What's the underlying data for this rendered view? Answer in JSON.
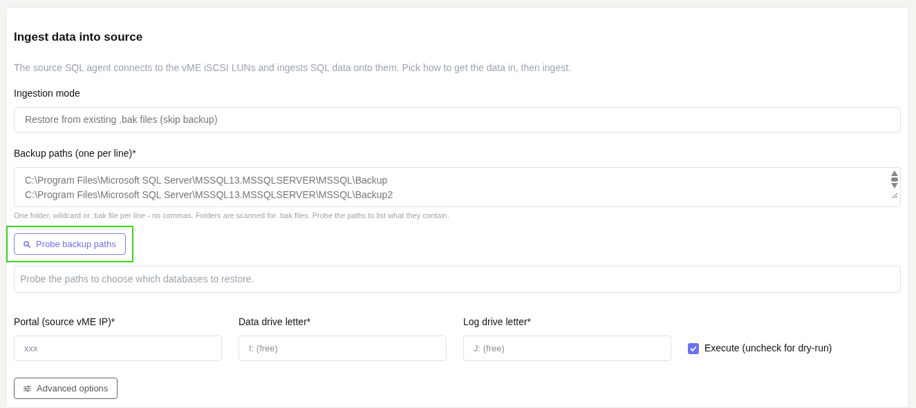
{
  "title": "Ingest data into source",
  "description": "The source SQL agent connects to the vME iSCSI LUNs and ingests SQL data onto them. Pick how to get the data in, then ingest.",
  "ingestion_mode": {
    "label": "Ingestion mode",
    "value": "Restore from existing .bak files (skip backup)"
  },
  "backup_paths": {
    "label": "Backup paths (one per line)*",
    "lines": [
      "C:\\Program Files\\Microsoft SQL Server\\MSSQL13.MSSQLSERVER\\MSSQL\\Backup",
      "C:\\Program Files\\Microsoft SQL Server\\MSSQL13.MSSQLSERVER\\MSSQL\\Backup2"
    ],
    "hint": "One folder, wildcard or .bak file per line - no commas. Folders are scanned for .bak files. Probe the paths to list what they contain."
  },
  "probe_button": {
    "label": "Probe backup paths",
    "focused": true
  },
  "probe_result": "Probe the paths to choose which databases to restore.",
  "fields": [
    {
      "label": "Portal (source vME IP)*",
      "placeholder": "xxx"
    },
    {
      "label": "Data drive letter*",
      "placeholder": "I: (free)"
    },
    {
      "label": "Log drive letter*",
      "placeholder": "J: (free)"
    }
  ],
  "execute": {
    "label": "Execute (uncheck for dry-run)",
    "checked": true
  },
  "advanced_button": {
    "label": "Advanced options"
  }
}
